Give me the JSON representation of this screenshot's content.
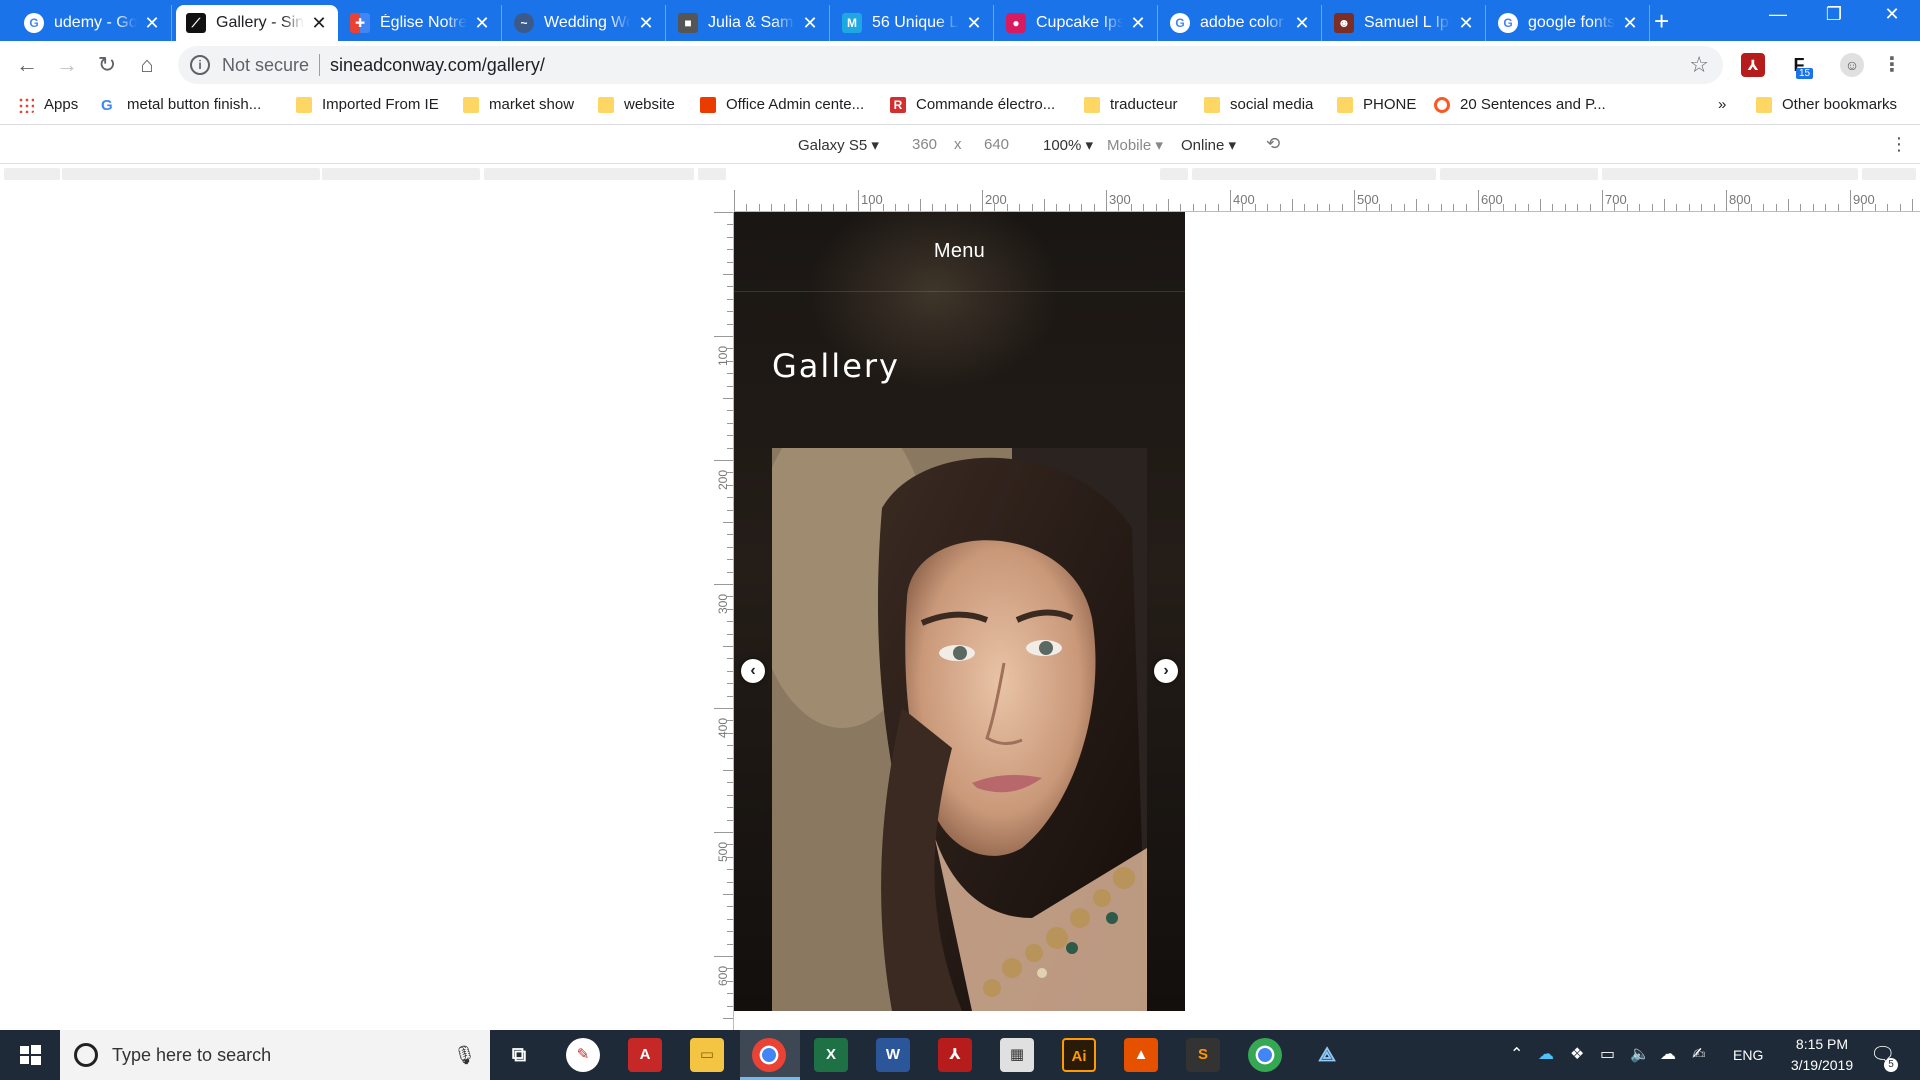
{
  "browser": {
    "tabs": [
      {
        "title": "udemy - Goo",
        "favicon": "google-icon",
        "active": false
      },
      {
        "title": "Gallery - Sine",
        "favicon": "site-icon",
        "active": true
      },
      {
        "title": "Église Notre",
        "favicon": "church-icon",
        "active": false
      },
      {
        "title": "Wedding Wo",
        "favicon": "wedding-icon",
        "active": false
      },
      {
        "title": "Julia & Sam",
        "favicon": "box-icon",
        "active": false
      },
      {
        "title": "56 Unique Lo",
        "favicon": "m-icon",
        "active": false
      },
      {
        "title": "Cupcake Ips",
        "favicon": "cupcake-icon",
        "active": false
      },
      {
        "title": "adobe color",
        "favicon": "google-icon",
        "active": false
      },
      {
        "title": "Samuel L Ips",
        "favicon": "person-icon",
        "active": false
      },
      {
        "title": "google fonts",
        "favicon": "google-icon",
        "active": false
      }
    ],
    "new_tab_label": "+",
    "security_label": "Not secure",
    "url": "sineadconway.com/gallery/",
    "extension_badge": "15"
  },
  "bookmarks": {
    "apps_label": "Apps",
    "items": [
      {
        "label": "metal button finish...",
        "icon": "google-icon"
      },
      {
        "label": "Imported From IE",
        "icon": "folder-icon"
      },
      {
        "label": "market show",
        "icon": "folder-icon"
      },
      {
        "label": "website",
        "icon": "folder-icon"
      },
      {
        "label": "Office Admin cente...",
        "icon": "office-icon"
      },
      {
        "label": "Commande électro...",
        "icon": "r-icon"
      },
      {
        "label": "traducteur",
        "icon": "folder-icon"
      },
      {
        "label": "social media",
        "icon": "folder-icon"
      },
      {
        "label": "PHONE",
        "icon": "folder-icon"
      },
      {
        "label": "20 Sentences and P...",
        "icon": "ring-icon"
      }
    ],
    "overflow_label": "»",
    "other_label": "Other bookmarks"
  },
  "device_toolbar": {
    "device": "Galaxy S5",
    "width": "360",
    "times": "x",
    "height": "640",
    "zoom": "100%",
    "mode": "Mobile",
    "network": "Online"
  },
  "rulers": {
    "horizontal": [
      "100",
      "200",
      "300",
      "400",
      "500",
      "600",
      "700",
      "800",
      "900"
    ],
    "vertical": [
      "100",
      "200",
      "300",
      "400",
      "500",
      "600"
    ]
  },
  "site": {
    "menu_label": "Menu",
    "page_title": "Gallery",
    "prev_label": "‹",
    "next_label": "›",
    "colors": {
      "background": "#1a1613",
      "text": "#ffffff"
    }
  },
  "taskbar": {
    "search_placeholder": "Type here to search",
    "language": "ENG",
    "time": "8:15 PM",
    "date": "3/19/2019",
    "notification_count": "5"
  },
  "colors": {
    "chrome_accent": "#1a73e8",
    "taskbar": "#1f2a38"
  }
}
